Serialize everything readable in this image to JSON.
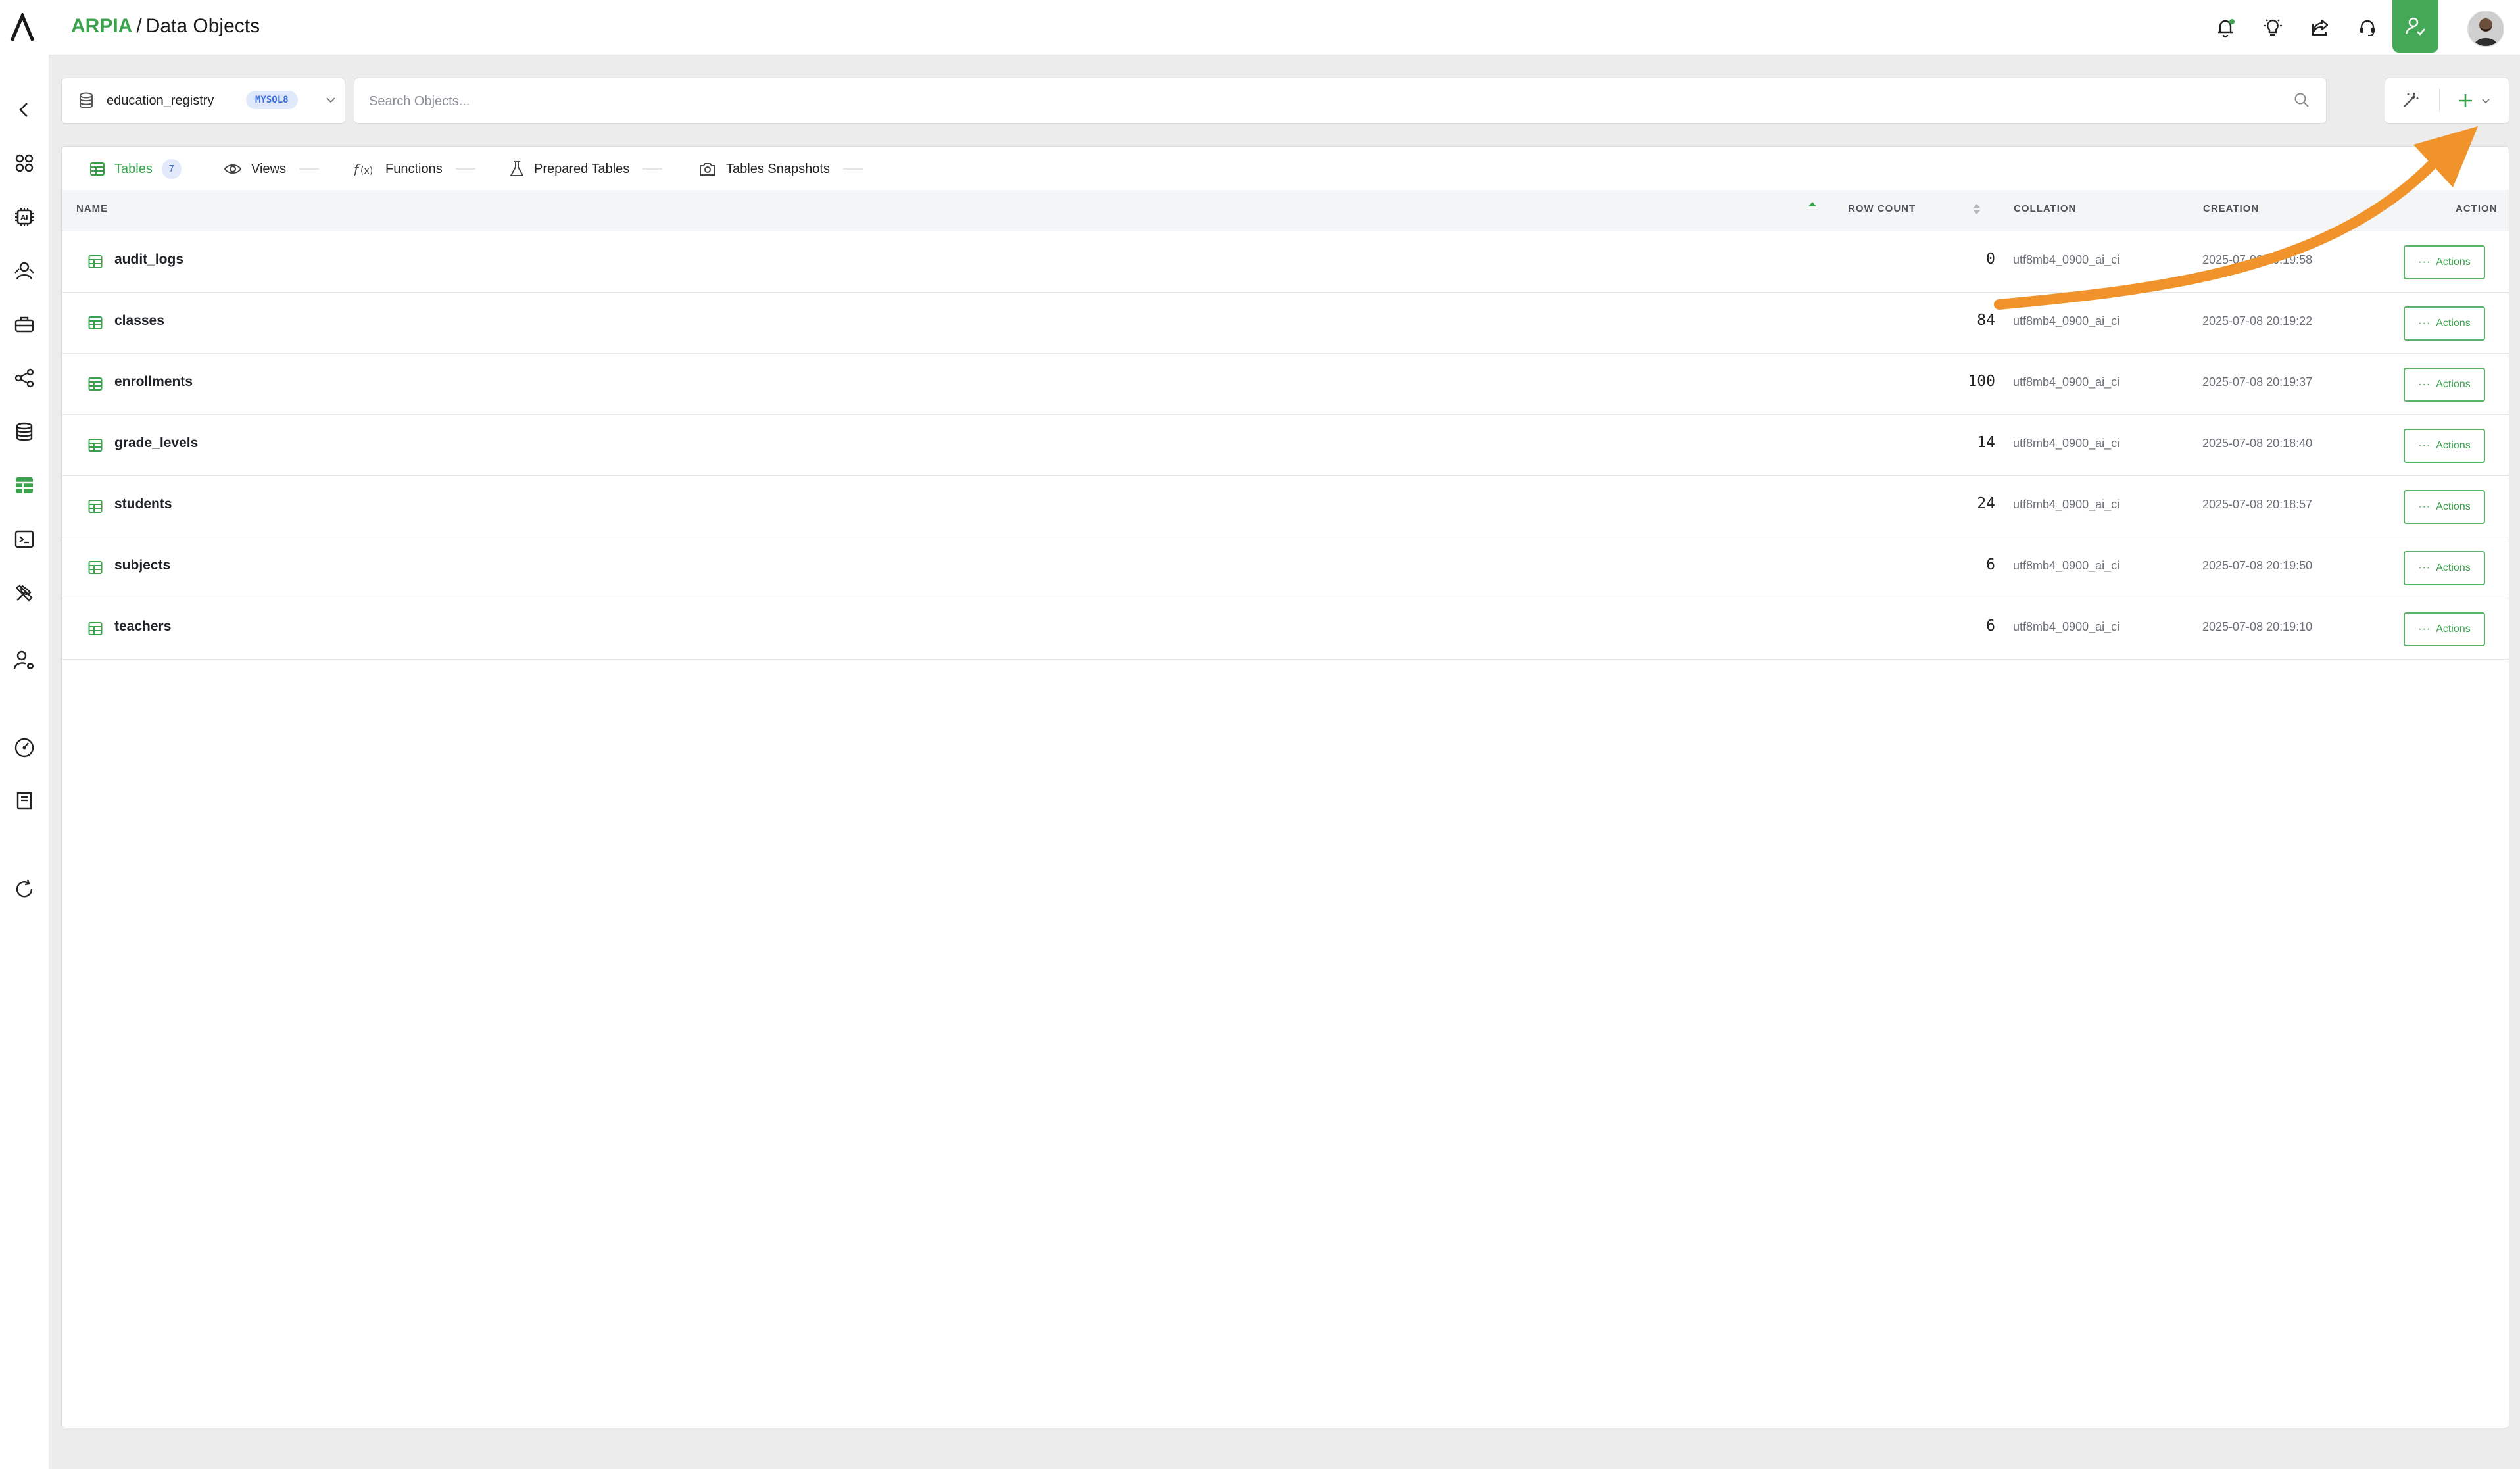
{
  "header": {
    "brand": "ARPIA",
    "separator": "/",
    "page_title": "Data Objects"
  },
  "toolbar": {
    "database_name": "education_registry",
    "database_badge": "MYSQL8",
    "search_placeholder": "Search Objects..."
  },
  "tabs": [
    {
      "label": "Tables",
      "count": "7",
      "active": true,
      "icon": "table-icon"
    },
    {
      "label": "Views",
      "icon": "eye-icon"
    },
    {
      "label": "Functions",
      "icon": "function-icon"
    },
    {
      "label": "Prepared Tables",
      "icon": "flask-icon"
    },
    {
      "label": "Tables Snapshots",
      "icon": "camera-icon"
    }
  ],
  "table": {
    "columns": {
      "name": "NAME",
      "row_count": "ROW COUNT",
      "collation": "COLLATION",
      "creation": "CREATION",
      "action": "ACTION"
    },
    "action_label": "Actions",
    "rows": [
      {
        "name": "audit_logs",
        "row_count": "0",
        "collation": "utf8mb4_0900_ai_ci",
        "creation": "2025-07-08 20:19:58"
      },
      {
        "name": "classes",
        "row_count": "84",
        "collation": "utf8mb4_0900_ai_ci",
        "creation": "2025-07-08 20:19:22"
      },
      {
        "name": "enrollments",
        "row_count": "100",
        "collation": "utf8mb4_0900_ai_ci",
        "creation": "2025-07-08 20:19:37"
      },
      {
        "name": "grade_levels",
        "row_count": "14",
        "collation": "utf8mb4_0900_ai_ci",
        "creation": "2025-07-08 20:18:40"
      },
      {
        "name": "students",
        "row_count": "24",
        "collation": "utf8mb4_0900_ai_ci",
        "creation": "2025-07-08 20:18:57"
      },
      {
        "name": "subjects",
        "row_count": "6",
        "collation": "utf8mb4_0900_ai_ci",
        "creation": "2025-07-08 20:19:50"
      },
      {
        "name": "teachers",
        "row_count": "6",
        "collation": "utf8mb4_0900_ai_ci",
        "creation": "2025-07-08 20:19:10"
      }
    ]
  },
  "colors": {
    "brand_green": "#3aa24c",
    "admin_green": "#43a956",
    "badge_blue": "#3a6fd8",
    "annotation_orange": "#f0932b"
  }
}
